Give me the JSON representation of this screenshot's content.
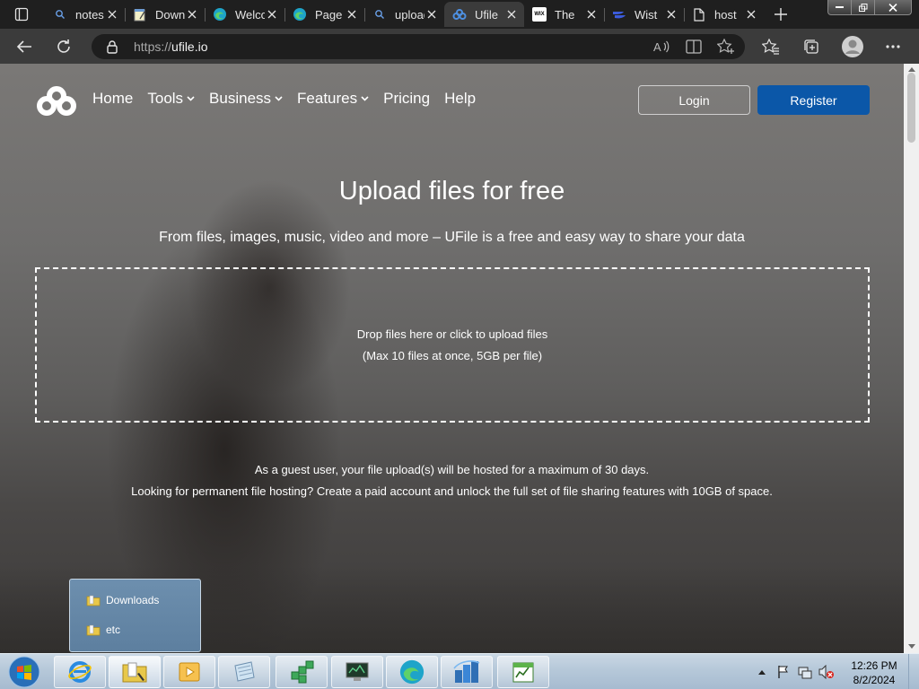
{
  "browser": {
    "tabs": [
      {
        "title": "notes",
        "favicon": "search-icon",
        "active": false
      },
      {
        "title": "Downloads",
        "favicon": "notepad-icon",
        "active": false
      },
      {
        "title": "Welcome",
        "favicon": "edge-icon",
        "active": false
      },
      {
        "title": "Page",
        "favicon": "edge-icon",
        "active": false
      },
      {
        "title": "upload",
        "favicon": "search-icon",
        "active": false
      },
      {
        "title": "Ufile",
        "favicon": "ufile-icon",
        "active": true
      },
      {
        "title": "The",
        "favicon": "wix-icon",
        "active": false
      },
      {
        "title": "Wist",
        "favicon": "wistia-icon",
        "active": false
      },
      {
        "title": "host",
        "favicon": "page-icon",
        "active": false
      }
    ],
    "wix_badge": "WIX",
    "url_protocol": "https://",
    "url_host": "ufile.io"
  },
  "site": {
    "nav": [
      {
        "label": "Home",
        "has_caret": false
      },
      {
        "label": "Tools",
        "has_caret": true
      },
      {
        "label": "Business",
        "has_caret": true
      },
      {
        "label": "Features",
        "has_caret": true
      },
      {
        "label": "Pricing",
        "has_caret": false
      },
      {
        "label": "Help",
        "has_caret": false
      }
    ],
    "login_label": "Login",
    "register_label": "Register",
    "hero_title": "Upload files for free",
    "hero_subtitle": "From files, images, music, video and more – UFile is a free and easy way to share your data",
    "dropzone_line1": "Drop files here or click to upload files",
    "dropzone_line2": "(Max 10 files at once, 5GB per file)",
    "notice_line1": "As a guest user, your file upload(s) will be hosted for a maximum of 30 days.",
    "notice_line2": "Looking for permanent file hosting? Create a paid account and unlock the full set of file sharing features with 10GB of space.",
    "accent_color": "#0b57a8"
  },
  "jumplist": {
    "items": [
      {
        "label": "Downloads"
      },
      {
        "label": "etc"
      }
    ]
  },
  "taskbar": {
    "apps": [
      "internet-explorer-icon",
      "file-explorer-icon",
      "media-player-icon",
      "notepad-icon",
      "game-icon",
      "remote-desktop-icon",
      "edge-icon",
      "network-icon",
      "spreadsheet-icon"
    ],
    "time": "12:26 PM",
    "date": "8/2/2024"
  }
}
